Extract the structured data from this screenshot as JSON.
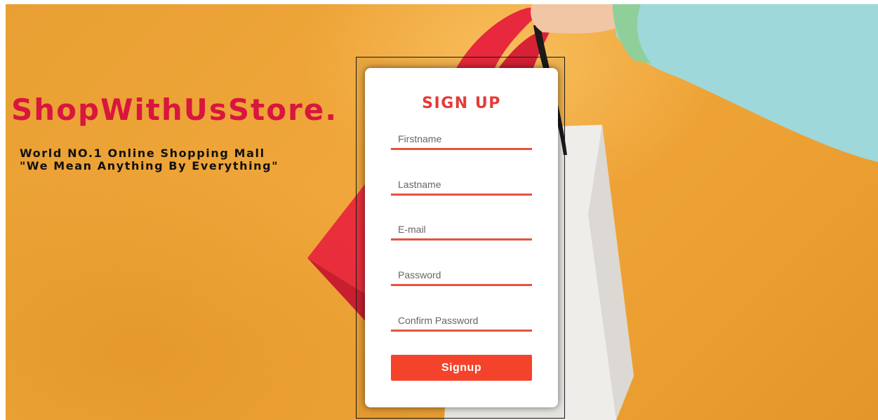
{
  "brand": {
    "name": "ShopWithUsStore.",
    "tagline_line1": "World NO.1 Online Shopping Mall",
    "tagline_line2": "\"We Mean Anything By Everything\""
  },
  "signup_form": {
    "title": "SIGN UP",
    "fields": [
      {
        "placeholder": "Firstname",
        "value": ""
      },
      {
        "placeholder": "Lastname",
        "value": ""
      },
      {
        "placeholder": "E-mail",
        "value": ""
      },
      {
        "placeholder": "Password",
        "value": ""
      },
      {
        "placeholder": "Confirm Password",
        "value": ""
      }
    ],
    "submit_label": "Signup"
  },
  "colors": {
    "brand_red": "#d8163e",
    "title_red": "#e63a36",
    "field_underline": "#e5533f",
    "button": "#f4432a",
    "background_orange": "#eda134"
  }
}
